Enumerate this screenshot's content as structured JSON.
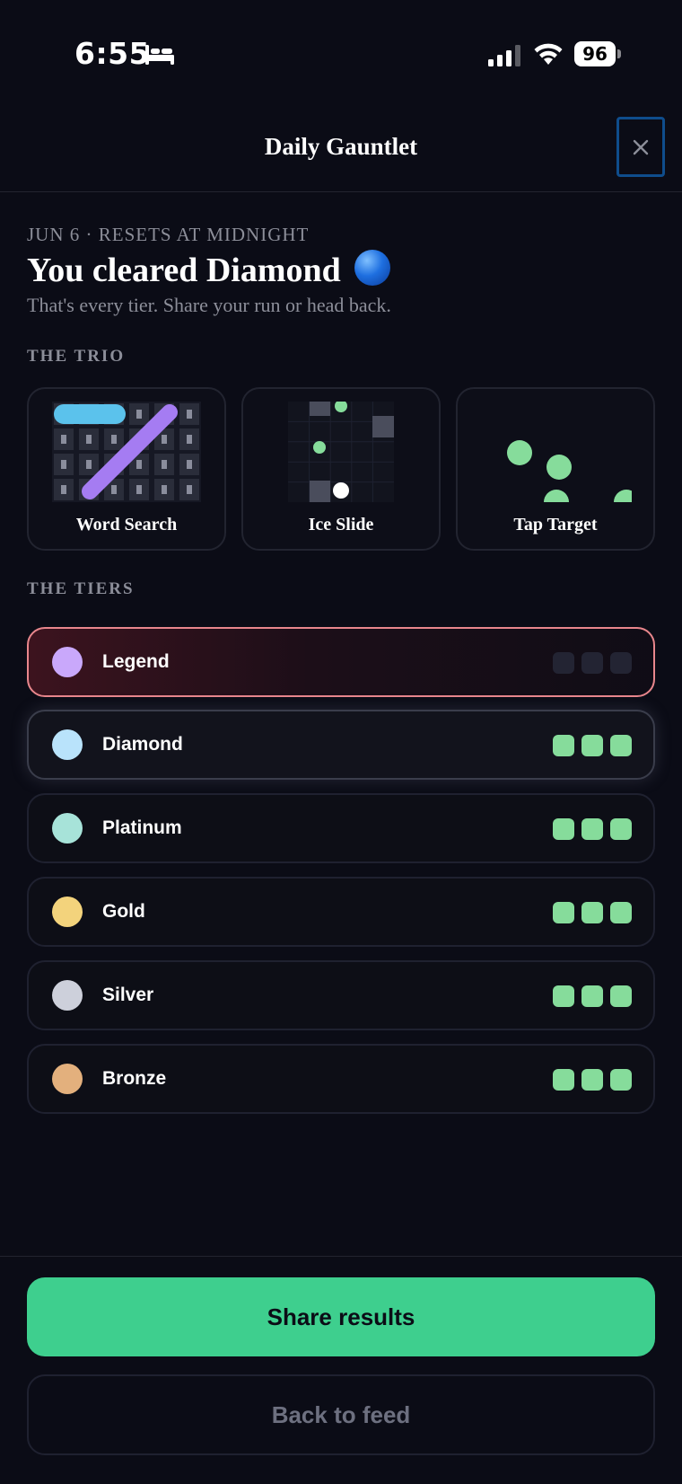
{
  "status_bar": {
    "time": "6:55",
    "battery": "96",
    "icons": [
      "bed-icon",
      "signal-icon",
      "wifi-icon",
      "battery-icon"
    ]
  },
  "header": {
    "title": "Daily Gauntlet",
    "close_icon": "close-icon"
  },
  "intro": {
    "date_line": "JUN 6 · RESETS AT MIDNIGHT",
    "headline": "You cleared Diamond",
    "headline_emoji": "blue-circle",
    "subtitle": "That's every tier. Share your run or head back."
  },
  "trio": {
    "label": "THE TRIO",
    "games": [
      {
        "name": "Word Search",
        "icon": "word-search-art"
      },
      {
        "name": "Ice Slide",
        "icon": "ice-slide-art"
      },
      {
        "name": "Tap Target",
        "icon": "tap-target-art"
      }
    ]
  },
  "tiers": {
    "label": "THE TIERS",
    "items": [
      {
        "name": "Legend",
        "color": "#c9a8fb",
        "completed": 0,
        "total": 3
      },
      {
        "name": "Diamond",
        "color": "#b9e3fb",
        "completed": 3,
        "total": 3
      },
      {
        "name": "Platinum",
        "color": "#a7e3d9",
        "completed": 3,
        "total": 3
      },
      {
        "name": "Gold",
        "color": "#f3d37c",
        "completed": 3,
        "total": 3
      },
      {
        "name": "Silver",
        "color": "#cdd0db",
        "completed": 3,
        "total": 3
      },
      {
        "name": "Bronze",
        "color": "#e3b07d",
        "completed": 3,
        "total": 3
      }
    ]
  },
  "actions": {
    "share_label": "Share results",
    "back_label": "Back to feed"
  },
  "colors": {
    "accent_green": "#3ecf8e",
    "check_done": "#86dc9b",
    "legend_border": "#e8868c",
    "background": "#0b0c16"
  }
}
